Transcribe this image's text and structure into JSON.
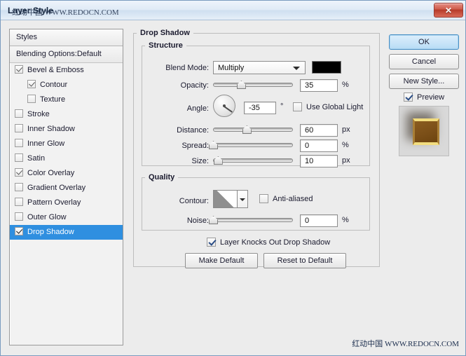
{
  "window": {
    "title": "Layer Style",
    "watermark_title": "红动中国 WWW.REDOCN.COM",
    "watermark_bottom": "红动中国 WWW.REDOCN.COM",
    "close_label": "✕"
  },
  "styles_panel": {
    "header": "Styles",
    "blending_options": "Blending Options:Default",
    "items": [
      {
        "label": "Bevel & Emboss",
        "checked": true,
        "indent": false,
        "selected": false
      },
      {
        "label": "Contour",
        "checked": true,
        "indent": true,
        "selected": false
      },
      {
        "label": "Texture",
        "checked": false,
        "indent": true,
        "selected": false
      },
      {
        "label": "Stroke",
        "checked": false,
        "indent": false,
        "selected": false
      },
      {
        "label": "Inner Shadow",
        "checked": false,
        "indent": false,
        "selected": false
      },
      {
        "label": "Inner Glow",
        "checked": false,
        "indent": false,
        "selected": false
      },
      {
        "label": "Satin",
        "checked": false,
        "indent": false,
        "selected": false
      },
      {
        "label": "Color Overlay",
        "checked": true,
        "indent": false,
        "selected": false
      },
      {
        "label": "Gradient Overlay",
        "checked": false,
        "indent": false,
        "selected": false
      },
      {
        "label": "Pattern Overlay",
        "checked": false,
        "indent": false,
        "selected": false
      },
      {
        "label": "Outer Glow",
        "checked": false,
        "indent": false,
        "selected": false
      },
      {
        "label": "Drop Shadow",
        "checked": true,
        "indent": false,
        "selected": true
      }
    ]
  },
  "drop_shadow": {
    "group_title": "Drop Shadow",
    "structure": {
      "title": "Structure",
      "blend_mode_label": "Blend Mode:",
      "blend_mode_value": "Multiply",
      "shadow_color": "#000000",
      "opacity_label": "Opacity:",
      "opacity_value": "35",
      "opacity_unit": "%",
      "opacity_percent": 35,
      "angle_label": "Angle:",
      "angle_value": "-35",
      "angle_unit": "°",
      "angle_degrees": -35,
      "use_global_light_label": "Use Global Light",
      "use_global_light_checked": false,
      "distance_label": "Distance:",
      "distance_value": "60",
      "distance_unit": "px",
      "distance_percent": 42,
      "spread_label": "Spread:",
      "spread_value": "0",
      "spread_unit": "%",
      "spread_percent": 0,
      "size_label": "Size:",
      "size_value": "10",
      "size_unit": "px",
      "size_percent": 6
    },
    "quality": {
      "title": "Quality",
      "contour_label": "Contour:",
      "anti_aliased_label": "Anti-aliased",
      "anti_aliased_checked": false,
      "noise_label": "Noise:",
      "noise_value": "0",
      "noise_unit": "%",
      "noise_percent": 0
    },
    "knockout_label": "Layer Knocks Out Drop Shadow",
    "knockout_checked": true,
    "make_default_label": "Make Default",
    "reset_default_label": "Reset to Default"
  },
  "right_panel": {
    "ok_label": "OK",
    "cancel_label": "Cancel",
    "new_style_label": "New Style...",
    "preview_label": "Preview",
    "preview_checked": true
  }
}
